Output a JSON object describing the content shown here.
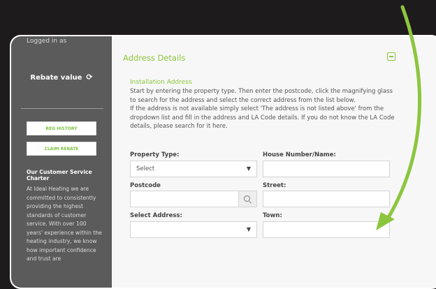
{
  "sidebar": {
    "logged_in": "Logged in as",
    "rebate_label": "Rebate value",
    "reg_history": "REG HISTORY",
    "claim_rebate": "CLAIM REBATE",
    "charter_title": "Our Customer Service Charter",
    "charter_text": "At Ideal Heating we are committed to consistently providing the highest standards of customer service. With over 100 years' experience within the heating industry, we know how important confidence and trust are"
  },
  "main": {
    "section_title": "Address Details",
    "install_title": "Installation Address",
    "instruction_1": "Start by entering the property type. Then enter the postcode, click the magnifying glass to search for the address and select the correct address from the list below.",
    "instruction_2": "If the address is not available simply select 'The address is not listed above' from the dropdown list and fill in the address and LA Code details. If you do not know the LA Code details, please search for it here.",
    "property_type_label": "Property Type:",
    "property_type_value": "Select",
    "house_label": "House Number/Name:",
    "postcode_label": "Postcode",
    "street_label": "Street:",
    "select_address_label": "Select Address:",
    "town_label": "Town:"
  },
  "colors": {
    "accent": "#8cc63f",
    "sidebar": "#5b5b5c",
    "arrow": "#8cc63f"
  },
  "icons": {
    "refresh": "refresh-icon",
    "collapse": "minus-square-icon",
    "search": "search-icon",
    "chevron": "chevron-down-icon",
    "arrow": "arrow-annotation"
  }
}
